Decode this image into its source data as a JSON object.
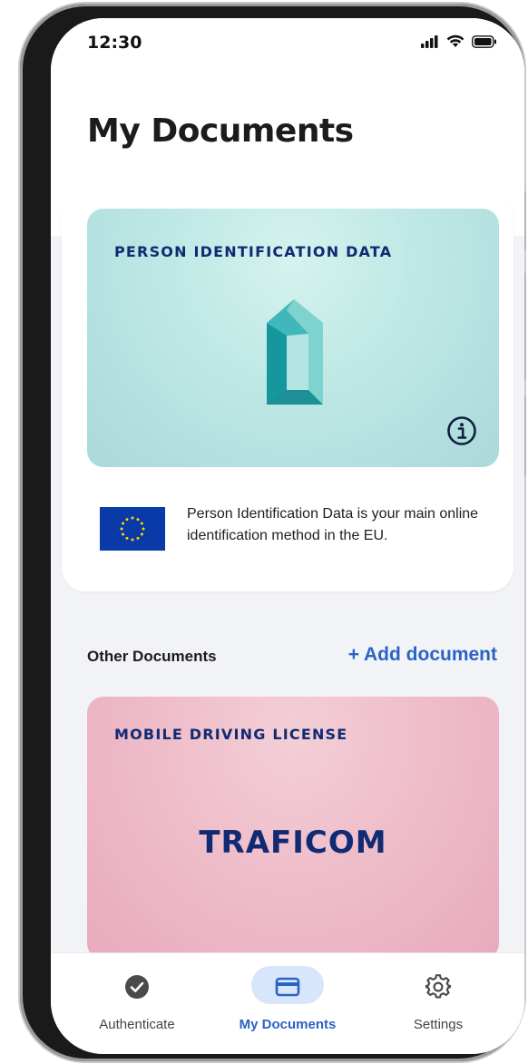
{
  "status_bar": {
    "time": "12:30",
    "icons": [
      "signal-icon",
      "wifi-icon",
      "battery-icon"
    ]
  },
  "page": {
    "title": "My Documents"
  },
  "main_document": {
    "title": "PERSON IDENTIFICATION DATA",
    "logo": "pid-logo",
    "info_icon": "info-icon",
    "description": "Person Identification Data is your main online identification method in the EU.",
    "colors": {
      "card": "#b8e3e0",
      "title": "#102a73",
      "logo": "#1a9fa5"
    }
  },
  "other_documents": {
    "label": "Other Documents",
    "add_label": "+ Add document",
    "cards": [
      {
        "title": "MOBILE DRIVING LICENSE",
        "brand": "TRAFICOM",
        "color": "#ecb6c5"
      }
    ]
  },
  "bottom_nav": {
    "items": [
      {
        "label": "Authenticate",
        "icon": "check-circle-icon",
        "active": false
      },
      {
        "label": "My Documents",
        "icon": "card-icon",
        "active": true
      },
      {
        "label": "Settings",
        "icon": "gear-icon",
        "active": false
      }
    ],
    "accent": "#2a63c4"
  }
}
